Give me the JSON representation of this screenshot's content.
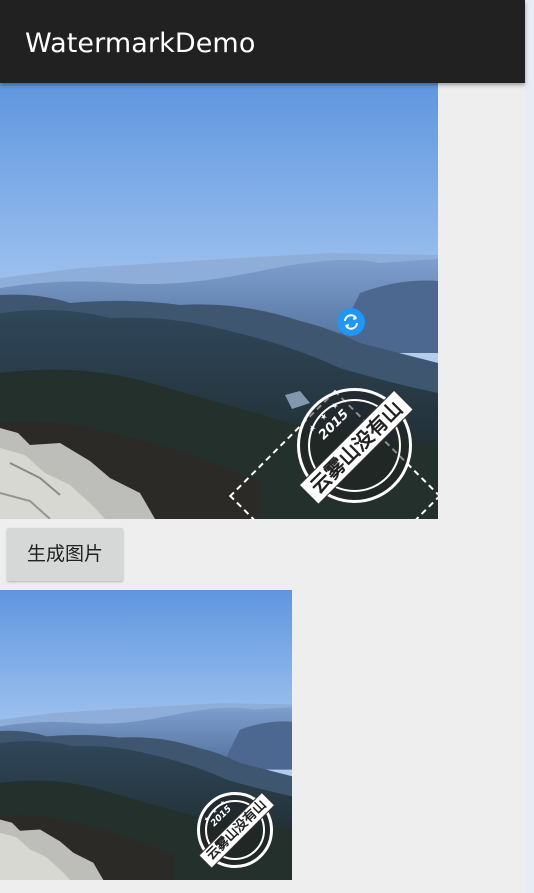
{
  "app_bar": {
    "title": "WatermarkDemo",
    "background": "#212121",
    "title_color": "#ffffff"
  },
  "editor": {
    "image_description_icon": "landscape-photo",
    "watermark": {
      "year": "2015",
      "banner_text": "云雾山没有山",
      "stars": "★ ★ ★"
    },
    "rotate_handle": {
      "icon": "rotate-icon",
      "color": "#2196f3"
    }
  },
  "actions": {
    "generate_label": "生成图片"
  },
  "result": {
    "watermark": {
      "year": "2015",
      "banner_text": "云雾山没有山",
      "stars": "★ ★ ★"
    }
  },
  "colors": {
    "accent": "#2196f3",
    "background": "#eeeeee",
    "button": "#d6d7d7"
  }
}
